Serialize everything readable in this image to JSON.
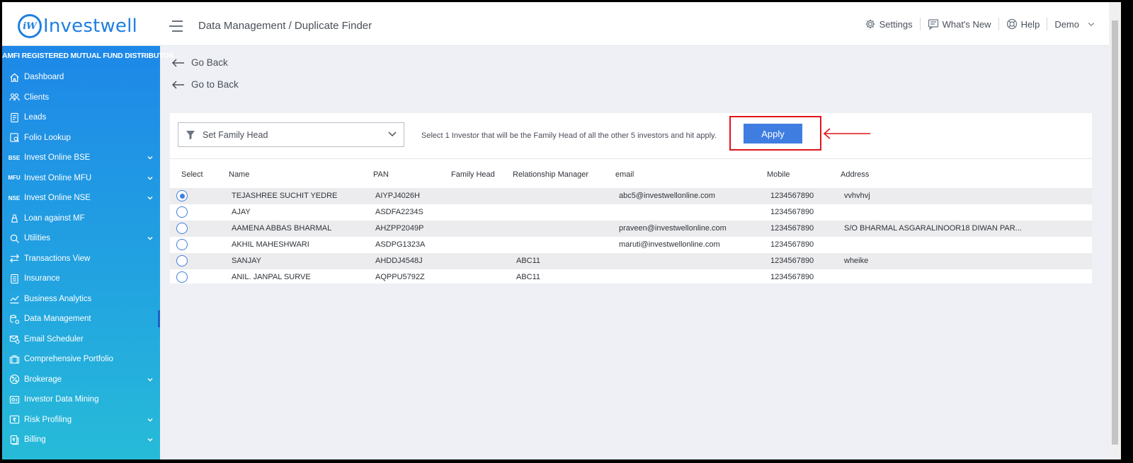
{
  "header": {
    "logo_mark": "iW",
    "logo_text": "Investwell",
    "breadcrumb": "Data Management / Duplicate Finder",
    "settings": "Settings",
    "whats_new": "What's New",
    "help": "Help",
    "user": "Demo"
  },
  "sidebar": {
    "distributor_label": "AMFI REGISTERED MUTUAL FUND DISTRIBUTOR",
    "items": [
      {
        "label": "Dashboard",
        "icon": "home-icon",
        "expandable": false
      },
      {
        "label": "Clients",
        "icon": "users-icon",
        "expandable": false
      },
      {
        "label": "Leads",
        "icon": "leads-icon",
        "expandable": false
      },
      {
        "label": "Folio Lookup",
        "icon": "folio-icon",
        "expandable": false
      },
      {
        "label": "Invest Online BSE",
        "icon": "bse-icon",
        "icon_text": "BSE",
        "expandable": true
      },
      {
        "label": "Invest Online MFU",
        "icon": "mfu-icon",
        "icon_text": "MFU",
        "expandable": true
      },
      {
        "label": "Invest Online NSE",
        "icon": "nse-icon",
        "icon_text": "NSE",
        "expandable": true
      },
      {
        "label": "Loan against MF",
        "icon": "loan-icon",
        "expandable": false
      },
      {
        "label": "Utilities",
        "icon": "utilities-icon",
        "expandable": true
      },
      {
        "label": "Transactions View",
        "icon": "transactions-icon",
        "expandable": false
      },
      {
        "label": "Insurance",
        "icon": "insurance-icon",
        "expandable": false
      },
      {
        "label": "Business Analytics",
        "icon": "analytics-icon",
        "expandable": false
      },
      {
        "label": "Data Management",
        "icon": "data-icon",
        "expandable": false
      },
      {
        "label": "Email Scheduler",
        "icon": "email-icon",
        "expandable": false
      },
      {
        "label": "Comprehensive Portfolio",
        "icon": "portfolio-icon",
        "expandable": false
      },
      {
        "label": "Brokerage",
        "icon": "brokerage-icon",
        "expandable": true
      },
      {
        "label": "Investor Data Mining",
        "icon": "mining-icon",
        "expandable": false
      },
      {
        "label": "Risk Profiling",
        "icon": "risk-icon",
        "expandable": true
      },
      {
        "label": "Billing",
        "icon": "billing-icon",
        "expandable": true
      }
    ]
  },
  "nav": {
    "go_back": "Go Back",
    "go_to_back": "Go to Back"
  },
  "toolbar": {
    "family_head_placeholder": "Set Family Head",
    "hint": "Select 1 Investor that will be the Family Head of all the other 5 investors and hit apply.",
    "apply_label": "Apply"
  },
  "table": {
    "columns": [
      "Select",
      "Name",
      "PAN",
      "Family Head",
      "Relationship Manager",
      "email",
      "Mobile",
      "Address"
    ],
    "rows": [
      {
        "selected": true,
        "name": "TEJASHREE SUCHIT YEDRE",
        "pan": "AIYPJ4026H",
        "family_head": "",
        "rm": "",
        "email": "abc5@investwellonline.com",
        "mobile": "1234567890",
        "address": "vvhvhvj"
      },
      {
        "selected": false,
        "name": "AJAY",
        "pan": "ASDFA2234S",
        "family_head": "",
        "rm": "",
        "email": "",
        "mobile": "1234567890",
        "address": ""
      },
      {
        "selected": false,
        "name": "AAMENA ABBAS BHARMAL",
        "pan": "AHZPP2049P",
        "family_head": "",
        "rm": "",
        "email": "praveen@investwellonline.com",
        "mobile": "1234567890",
        "address": "S/O BHARMAL ASGARALINOOR18 DIWAN PAR..."
      },
      {
        "selected": false,
        "name": "AKHIL MAHESHWARI",
        "pan": "ASDPG1323A",
        "family_head": "",
        "rm": "",
        "email": "maruti@investwellonline.com",
        "mobile": "1234567890",
        "address": ""
      },
      {
        "selected": false,
        "name": "SANJAY",
        "pan": "AHDDJ4548J",
        "family_head": "",
        "rm": "ABC11",
        "email": "",
        "mobile": "1234567890",
        "address": "wheike"
      },
      {
        "selected": false,
        "name": "ANIL. JANPAL SURVE",
        "pan": "AQPPU5792Z",
        "family_head": "",
        "rm": "ABC11",
        "email": "",
        "mobile": "1234567890",
        "address": ""
      }
    ]
  },
  "colors": {
    "brand": "#1f7fe0",
    "primary_button": "#3f7ee0",
    "annotation": "#e0141a"
  }
}
